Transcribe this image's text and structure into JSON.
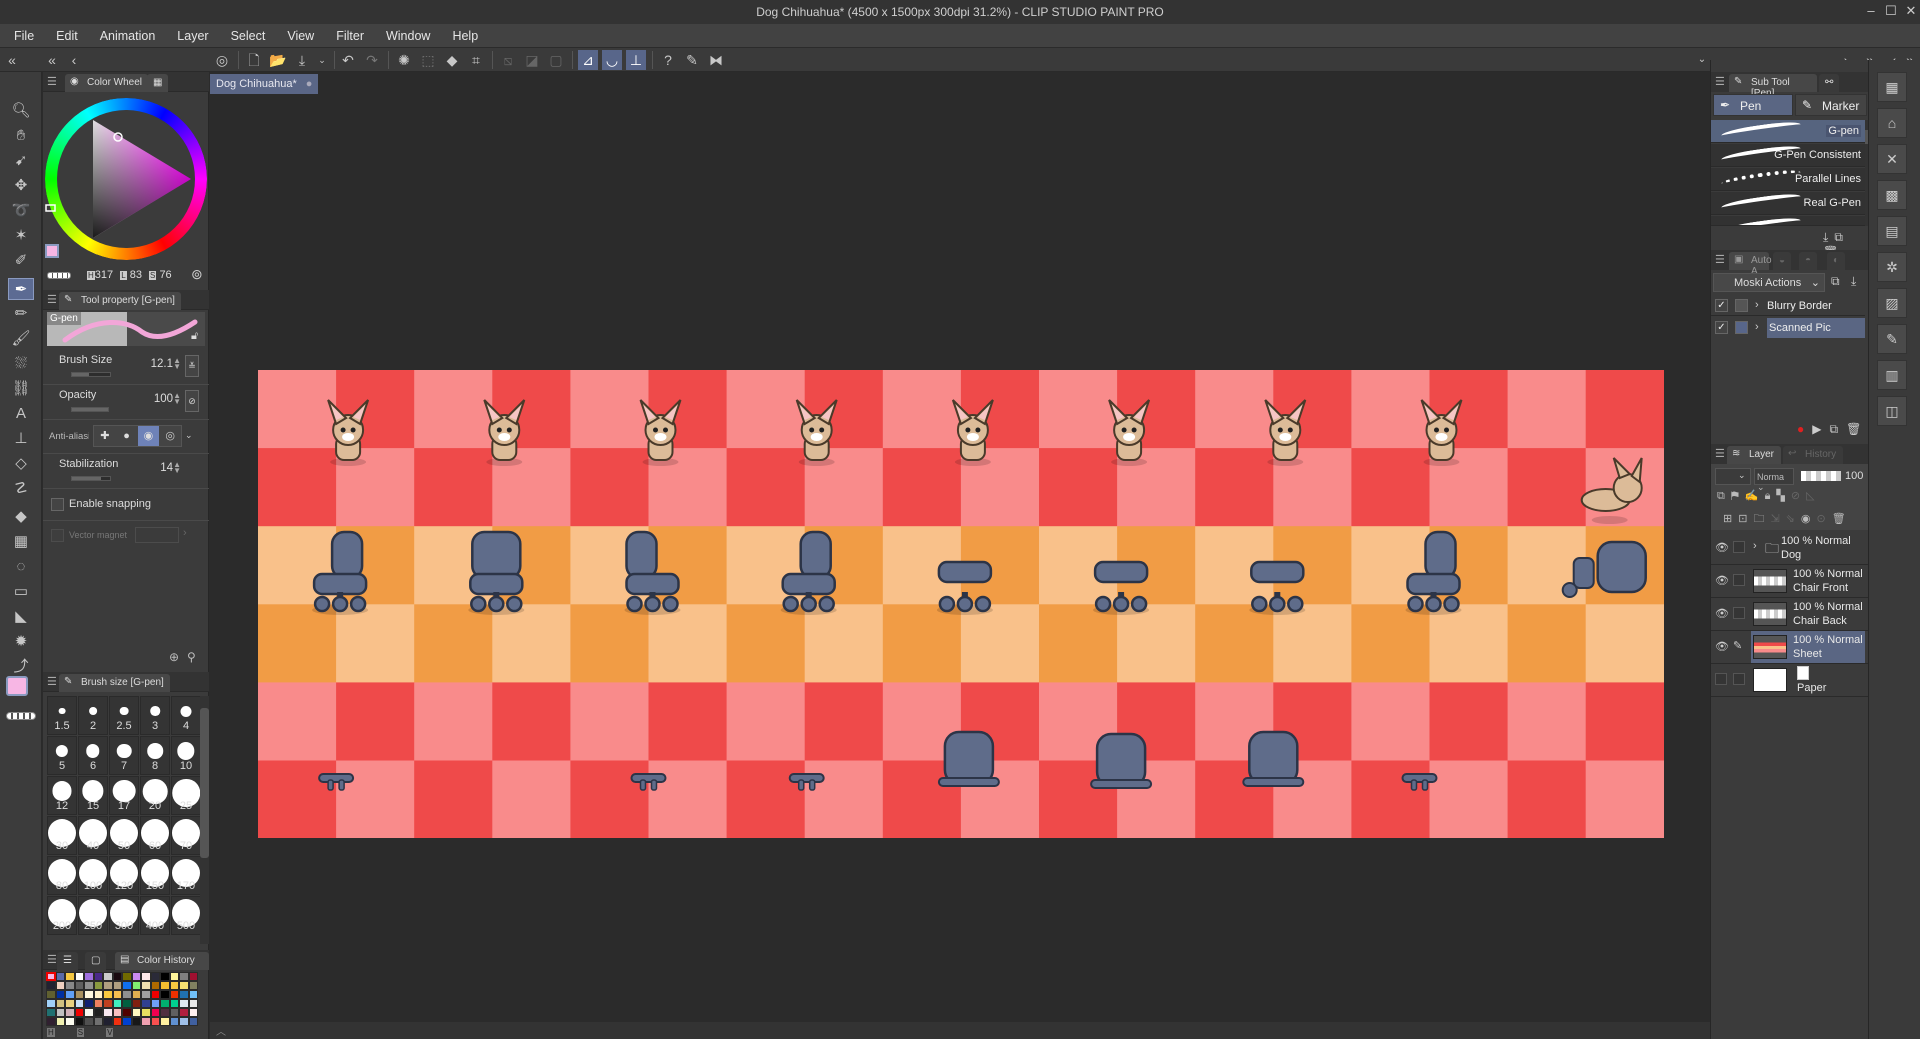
{
  "window": {
    "title": "Dog Chihuahua* (4500 x 1500px 300dpi 31.2%) - CLIP STUDIO PAINT PRO",
    "controls": [
      "minimize",
      "maximize",
      "close"
    ]
  },
  "menu": [
    "File",
    "Edit",
    "Animation",
    "Layer",
    "Select",
    "View",
    "Filter",
    "Window",
    "Help"
  ],
  "document_tab": {
    "label": "Dog Chihuahua*"
  },
  "color_wheel": {
    "tab": "Color Wheel",
    "h_label": "H",
    "h": "317",
    "l_label": "L",
    "l": "83",
    "s_label": "S",
    "s": "76",
    "main_color": "#f7b6e4",
    "sub_color": "#3c3c3c"
  },
  "tool_property": {
    "tab": "Tool property [G-pen]",
    "preview_label": "G-pen",
    "brush_size_label": "Brush Size",
    "brush_size": "12.1",
    "opacity_label": "Opacity",
    "opacity": "100",
    "anti_aliasing_label": "Anti-aliasing",
    "stabilization_label": "Stabilization",
    "stabilization": "14",
    "snapping_label": "Enable snapping",
    "snapping": false,
    "vector_magnet_label": "Vector magnet"
  },
  "brush_size_palette": {
    "tab": "Brush size [G-pen]",
    "sizes": [
      "1.5",
      "2",
      "2.5",
      "3",
      "4",
      "5",
      "6",
      "7",
      "8",
      "10",
      "12",
      "15",
      "17",
      "20",
      "25",
      "30",
      "40",
      "50",
      "60",
      "70",
      "80",
      "100",
      "120",
      "150",
      "170",
      "200",
      "250",
      "300",
      "400",
      "500"
    ]
  },
  "color_history": {
    "tab": "Color History",
    "footer": [
      "H",
      "S",
      "V"
    ],
    "colors": [
      "#f7b6e4",
      "#5a6aa8",
      "#f5c842",
      "#ffffff",
      "#a070e0",
      "#4a2a8a",
      "#cccccc",
      "#1a0a10",
      "#706a00",
      "#c98af0",
      "#fde8e8",
      "#2a2a38",
      "#000000",
      "#fff59a",
      "#808080",
      "#a01030",
      "#222230",
      "#f0d0c0",
      "#888888",
      "#606060",
      "#909090",
      "#8a9a40",
      "#b0a080",
      "#b0a080",
      "#1070f0",
      "#80f070",
      "#f0e0b0",
      "#b06a00",
      "#f8c030",
      "#f8c840",
      "#f8e070",
      "#808060",
      "#606030",
      "#0030a0",
      "#60a0f8",
      "#a89060",
      "#fff8e0",
      "#fff0c8",
      "#f8c840",
      "#f8c050",
      "#909090",
      "#e0b050",
      "#a0a0a0",
      "#f00000",
      "#000000",
      "#f03000",
      "#2070b0",
      "#70c0f8",
      "#a0d0f8",
      "#d0c080",
      "#e8d080",
      "#c8e0f8",
      "#102070",
      "#f08060",
      "#c04020",
      "#40f0c0",
      "#006040",
      "#802010",
      "#304090",
      "#70a0f8",
      "#00b070",
      "#00d090",
      "#e0e8f0",
      "#e8e8e8",
      "#207070",
      "#c0c0c0",
      "#d0b0b8",
      "#f00000",
      "#f8f8f0",
      "#202020",
      "#f8e8f0",
      "#f8c0c0",
      "#500000",
      "#fff8c0",
      "#e8e060",
      "#f00050",
      "#503040",
      "#606060",
      "#b02040",
      "#fff0f0",
      "#302030",
      "#f0f0b0",
      "#fcfcf0",
      "#101010",
      "#505050",
      "#707070",
      "#202030",
      "#f03010",
      "#0040d0",
      "#181818",
      "#f0a0b0",
      "#f85050",
      "#fff0a0",
      "#6090d0",
      "#a0c0e8",
      "#4060a0"
    ]
  },
  "sub_tool": {
    "tab": "Sub Tool [Pen]",
    "groups": [
      "Pen",
      "Marker"
    ],
    "items": [
      "G-pen",
      "G-Pen Consistent",
      "Parallel Lines",
      "Real G-Pen"
    ],
    "selected": "G-pen"
  },
  "auto_actions": {
    "tab": "Auto A",
    "set": "Moski Actions",
    "items": [
      {
        "label": "Blurry Border",
        "checked": true
      },
      {
        "label": "Scanned Pic",
        "checked": true
      }
    ]
  },
  "layer_panel": {
    "tabs": [
      "Layer",
      "History"
    ],
    "blend_mode": "Norma",
    "opacity": "100",
    "layers": [
      {
        "opacity_mode": "100 % Normal",
        "name": "Dog",
        "type": "folder",
        "visible": true
      },
      {
        "opacity_mode": "100 % Normal",
        "name": "Chair Front",
        "visible": true
      },
      {
        "opacity_mode": "100 % Normal",
        "name": "Chair Back",
        "visible": true
      },
      {
        "opacity_mode": "100 % Normal",
        "name": "Sheet",
        "visible": true,
        "selected": true
      },
      {
        "opacity_mode": "",
        "name": "Paper",
        "visible": false
      }
    ]
  },
  "canvas": {
    "colors": {
      "red_light": "#f98b8b",
      "red_dark": "#ef4a4a",
      "orange_light": "#f9c18a",
      "orange_dark": "#f19c45",
      "dog": "#dcbb98",
      "chair": "#5f6c8a",
      "chair_outline": "#2c3447"
    }
  }
}
